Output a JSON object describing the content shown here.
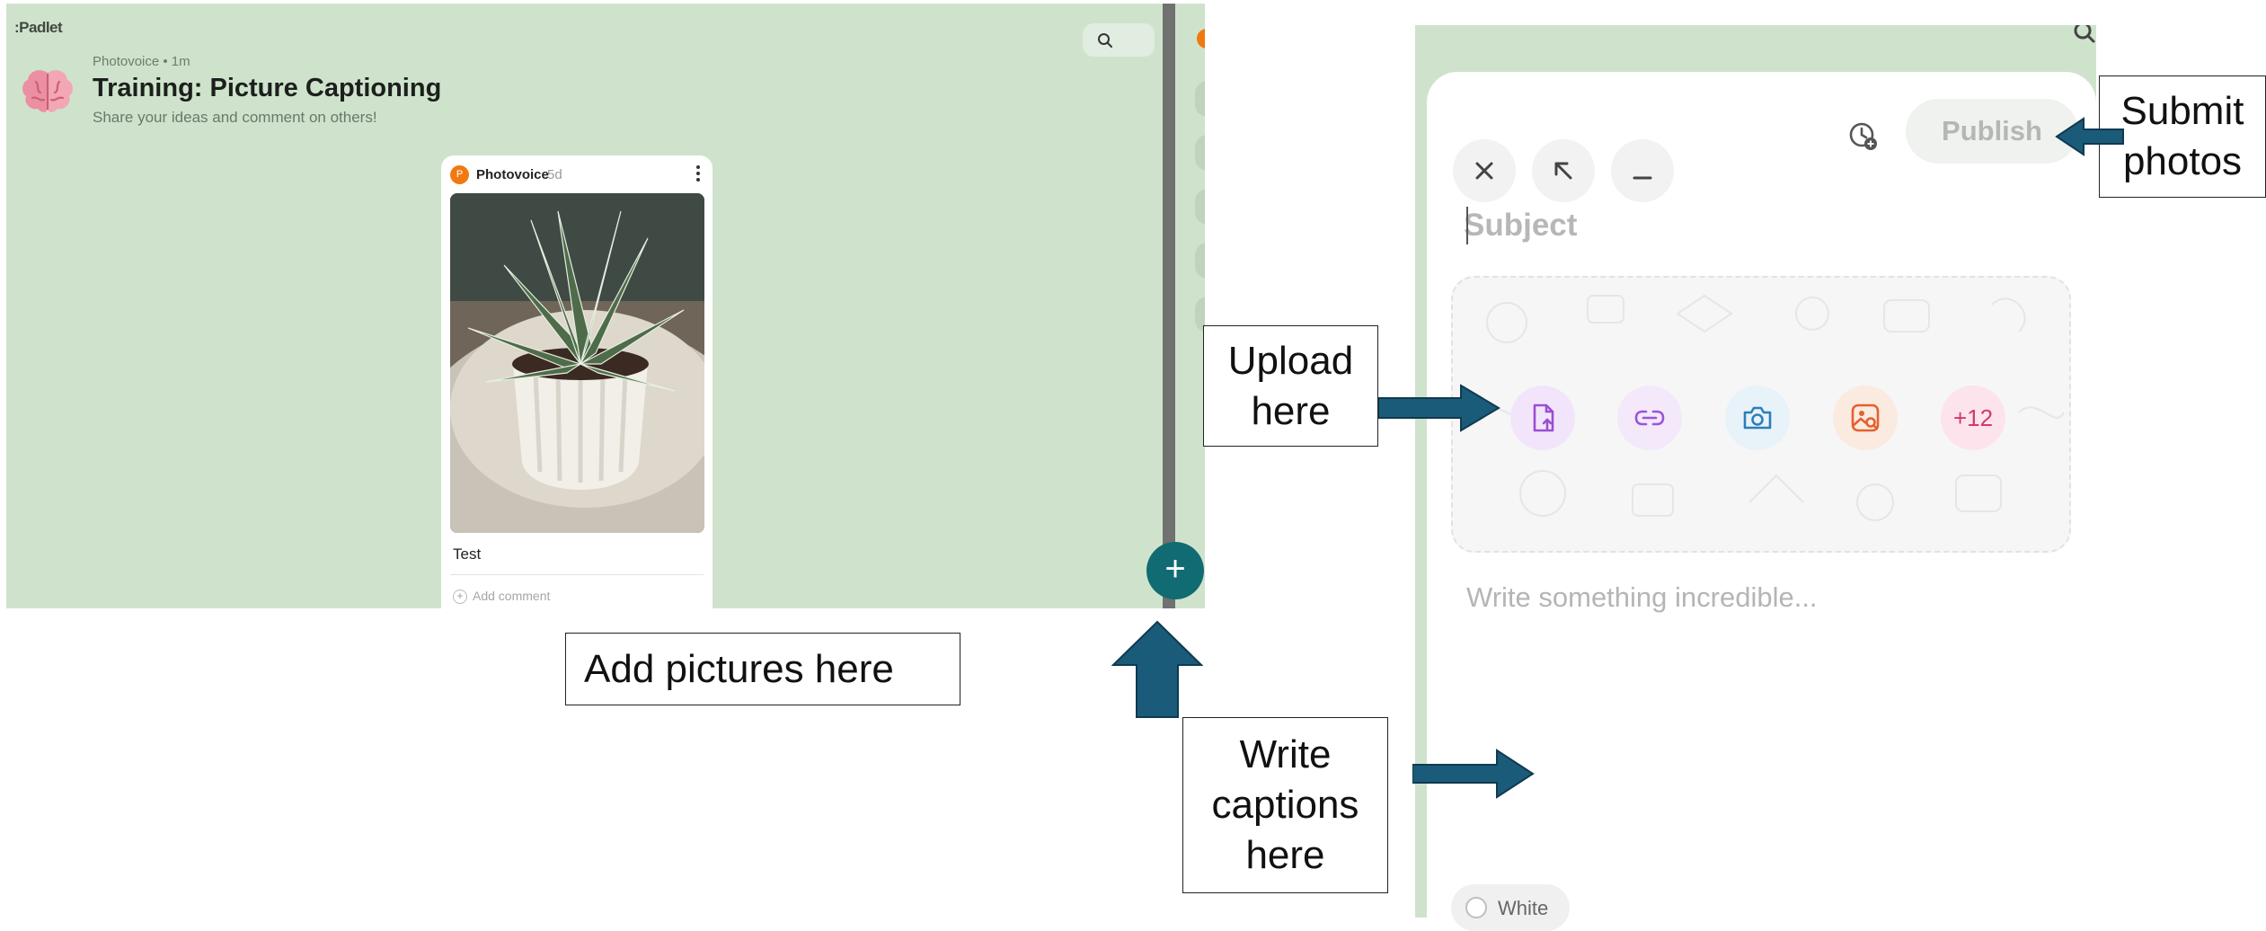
{
  "board": {
    "logo": ":Padlet",
    "meta": "Photovoice • 1m",
    "title": "Training: Picture Captioning",
    "subtitle": "Share your ideas and comment on others!",
    "post": {
      "avatar_letter": "P",
      "author": "Photovoice",
      "age": "5d",
      "caption": "Test",
      "add_comment": "Add comment"
    },
    "add_button": "+"
  },
  "composer": {
    "publish_label": "Publish",
    "subject_placeholder": "Subject",
    "more_label": "+12",
    "body_placeholder": "Write something incredible...",
    "color_label": "White"
  },
  "annotations": {
    "add_pictures": "Add pictures here",
    "upload": "Upload\nhere",
    "captions": "Write\ncaptions\nhere",
    "submit": "Submit\nphotos"
  },
  "colors": {
    "board_bg": "#cfe3cc",
    "accent_teal": "#116b72",
    "arrow_fill": "#1b5b7a",
    "avatar_orange": "#f07a12"
  },
  "icons": [
    "brain-icon",
    "search-icon",
    "kebab-menu-icon",
    "plus-icon",
    "close-icon",
    "expand-icon",
    "minimize-icon",
    "schedule-icon",
    "upload-file-icon",
    "link-icon",
    "camera-icon",
    "image-search-icon"
  ]
}
